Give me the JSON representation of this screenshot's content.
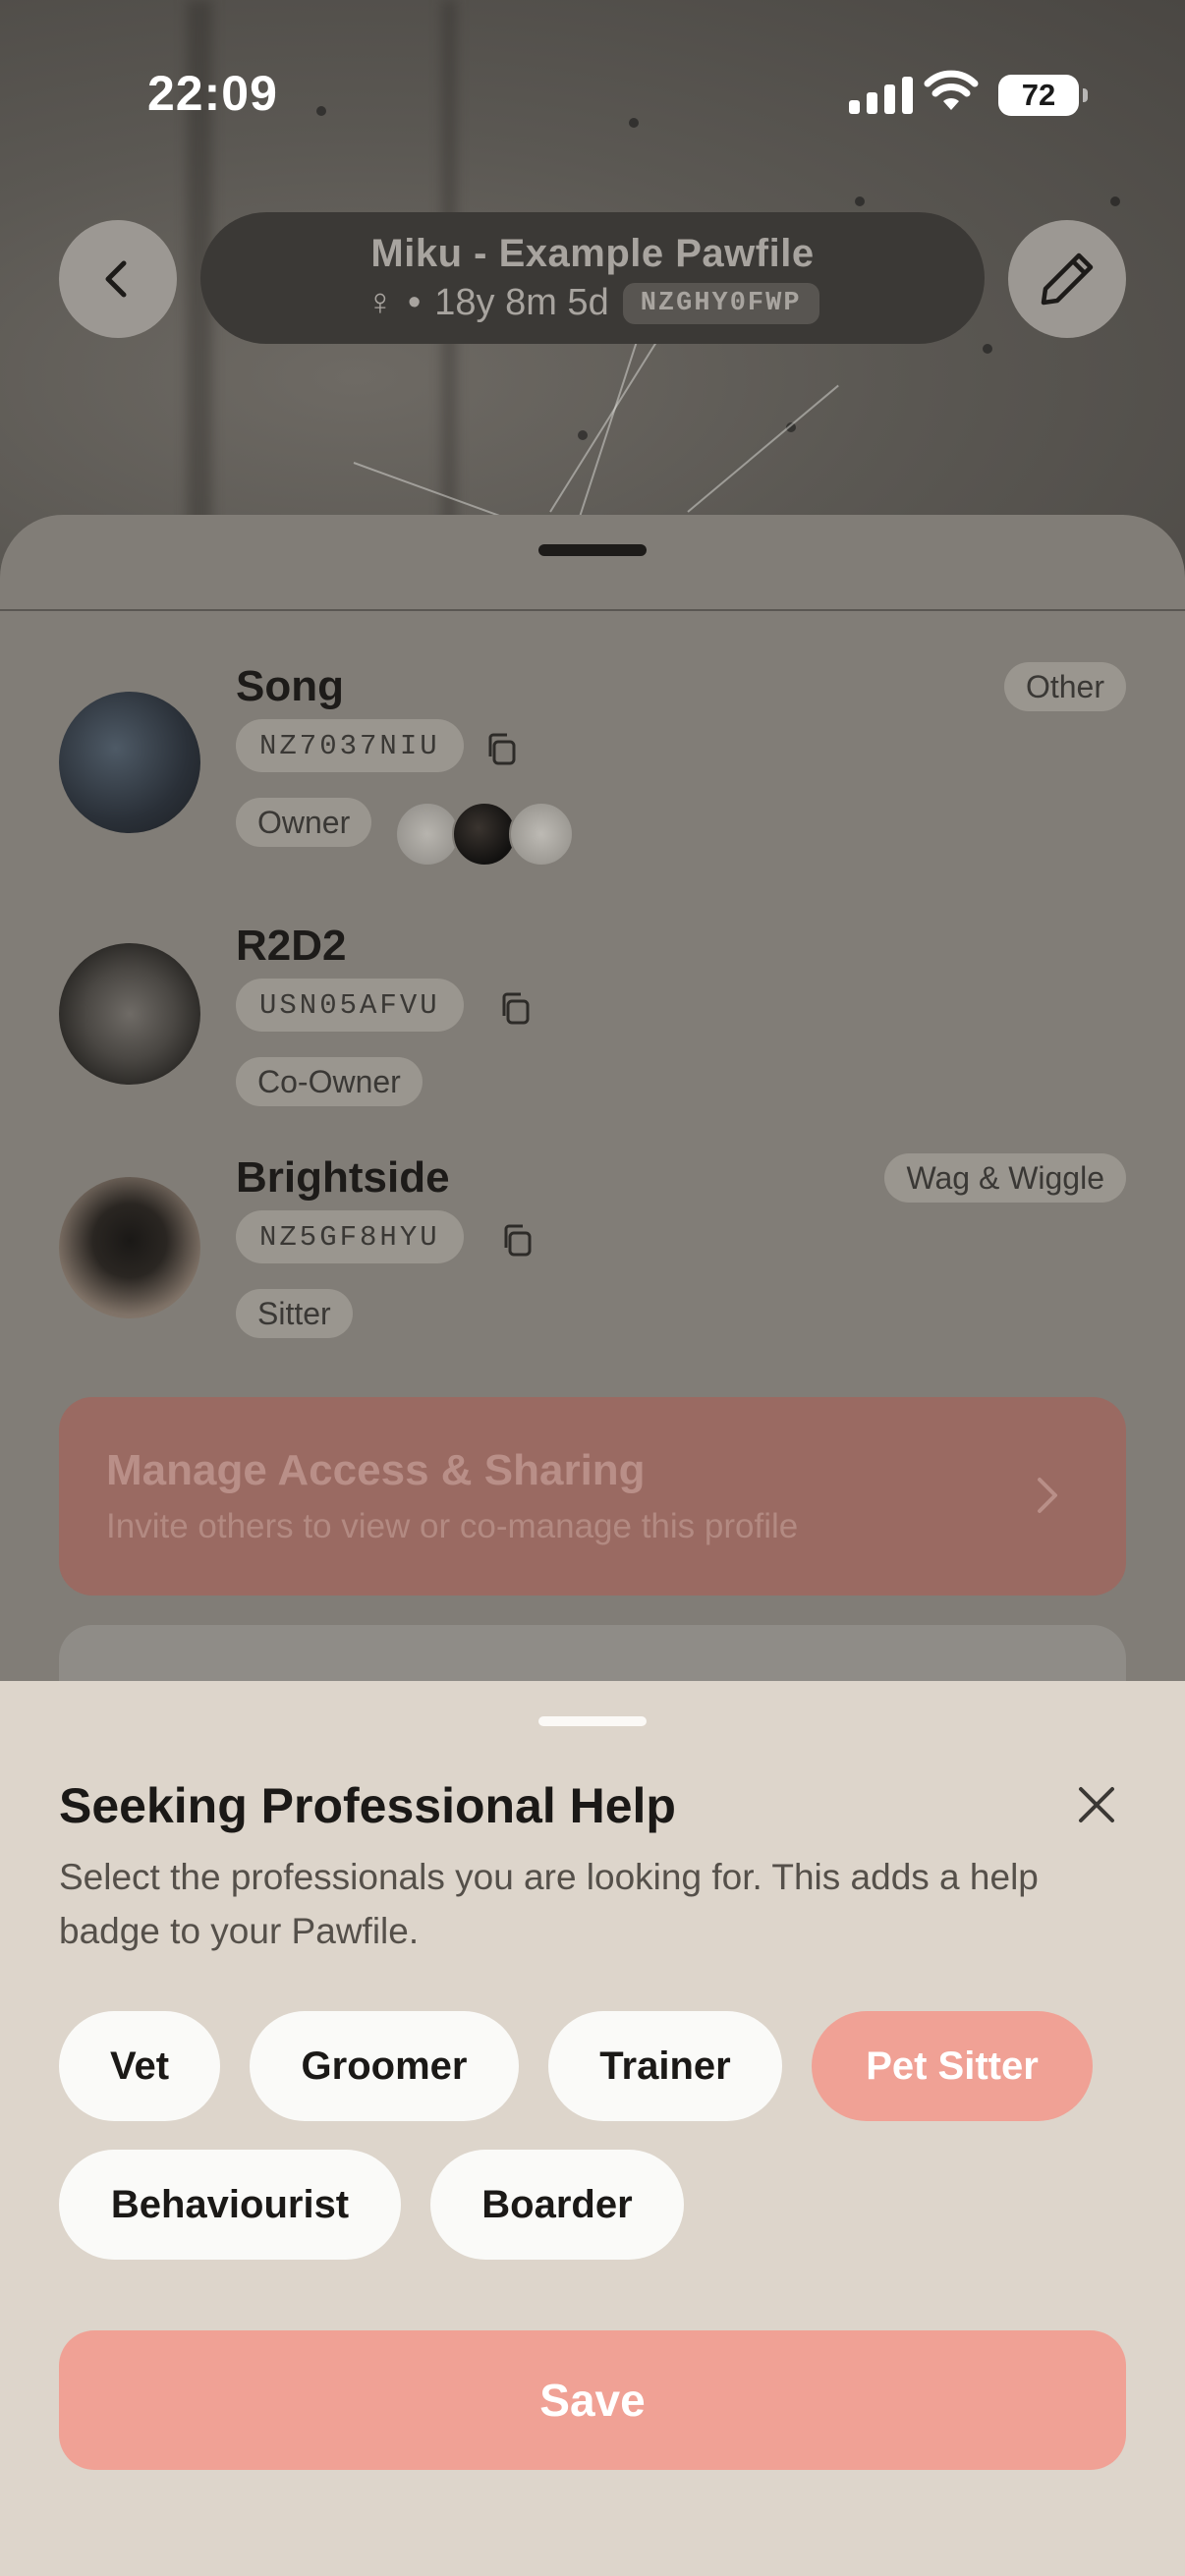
{
  "status_bar": {
    "time": "22:09",
    "battery": "72"
  },
  "header": {
    "title": "Miku - Example Pawfile",
    "sex_symbol": "♀",
    "separator": "•",
    "age": "18y 8m 5d",
    "pawfile_id": "NZGHY0FWP"
  },
  "people": [
    {
      "name": "Song",
      "code": "NZ7037NIU",
      "role": "Owner",
      "tag": "Other"
    },
    {
      "name": "R2D2",
      "code": "USN05AFVU",
      "role": "Co-Owner",
      "tag": ""
    },
    {
      "name": "Brightside",
      "code": "NZ5GF8HYU",
      "role": "Sitter",
      "tag": "Wag & Wiggle"
    }
  ],
  "manage": {
    "title": "Manage Access & Sharing",
    "subtitle": "Invite others to view or co-manage this profile"
  },
  "sheet": {
    "title": "Seeking Professional Help",
    "description": "Select the professionals you are looking for. This adds a help badge to your Pawfile.",
    "options": [
      {
        "label": "Vet",
        "selected": false
      },
      {
        "label": "Groomer",
        "selected": false
      },
      {
        "label": "Trainer",
        "selected": false
      },
      {
        "label": "Pet Sitter",
        "selected": true
      },
      {
        "label": "Behaviourist",
        "selected": false
      },
      {
        "label": "Boarder",
        "selected": false
      }
    ],
    "save_label": "Save"
  },
  "colors": {
    "accent": "#f0a195",
    "sheet_bg": "#ddd5cb",
    "overlay_card": "#817d77"
  },
  "icons": [
    "back-chevron-icon",
    "pencil-icon",
    "copy-icon",
    "chevron-right-icon",
    "close-icon",
    "signal-icon",
    "wifi-icon"
  ]
}
